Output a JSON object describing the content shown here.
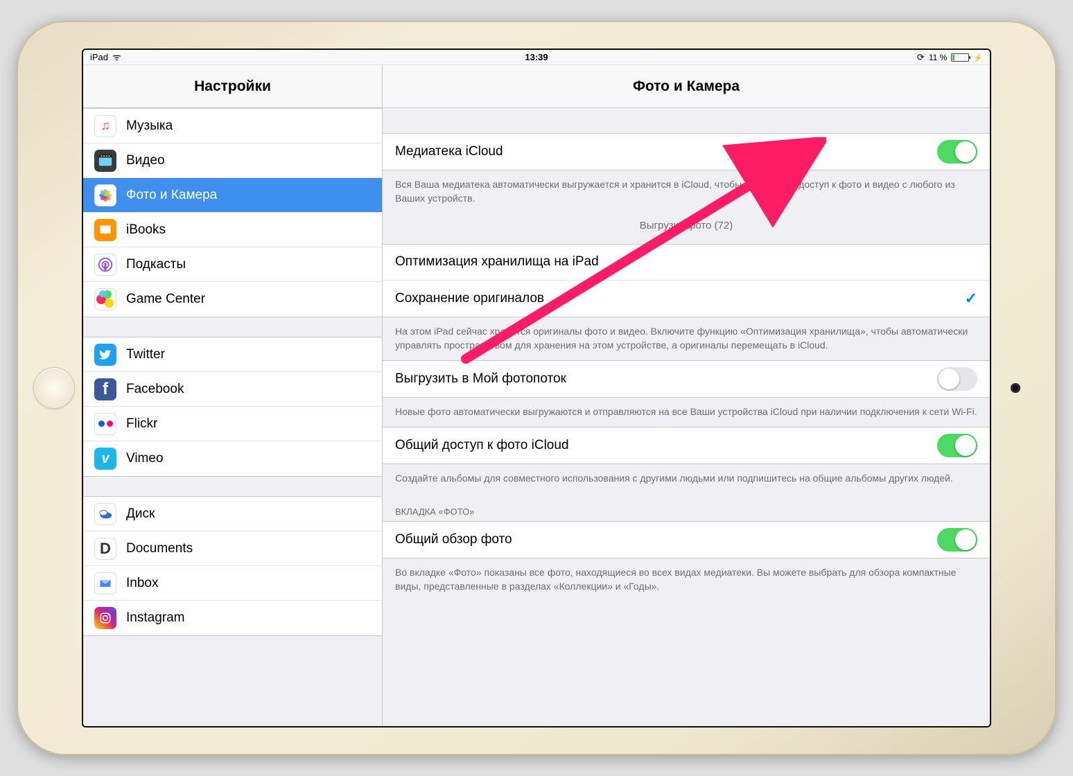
{
  "statusbar": {
    "device": "iPad",
    "time": "13:39",
    "battery_percent": "11 %"
  },
  "sidebar": {
    "title": "Настройки",
    "groups": [
      {
        "items": [
          {
            "id": "music",
            "label": "Музыка",
            "selected": false
          },
          {
            "id": "video",
            "label": "Видео",
            "selected": false
          },
          {
            "id": "photos",
            "label": "Фото и Камера",
            "selected": true
          },
          {
            "id": "ibooks",
            "label": "iBooks",
            "selected": false
          },
          {
            "id": "podcasts",
            "label": "Подкасты",
            "selected": false
          },
          {
            "id": "gamecenter",
            "label": "Game Center",
            "selected": false
          }
        ]
      },
      {
        "items": [
          {
            "id": "twitter",
            "label": "Twitter",
            "selected": false
          },
          {
            "id": "facebook",
            "label": "Facebook",
            "selected": false
          },
          {
            "id": "flickr",
            "label": "Flickr",
            "selected": false
          },
          {
            "id": "vimeo",
            "label": "Vimeo",
            "selected": false
          }
        ]
      },
      {
        "items": [
          {
            "id": "disk",
            "label": "Диск",
            "selected": false
          },
          {
            "id": "documents",
            "label": "Documents",
            "selected": false
          },
          {
            "id": "inbox",
            "label": "Inbox",
            "selected": false
          },
          {
            "id": "instagram",
            "label": "Instagram",
            "selected": false
          }
        ]
      }
    ]
  },
  "main": {
    "title": "Фото и Камера",
    "icloud_library": {
      "label": "Медиатека iCloud",
      "on": true,
      "footer": "Вся Ваша медиатека автоматически выгружается и хранится в iCloud, чтобы обеспечить доступ к фото и видео с любого из Ваших устройств.",
      "upload_status": "Выгрузка фото (72)"
    },
    "storage": {
      "optimize_label": "Оптимизация хранилища на iPad",
      "originals_label": "Сохранение оригиналов",
      "originals_selected": true,
      "footer": "На этом iPad сейчас хранятся оригиналы фото и видео. Включите функцию «Оптимизация хранилища», чтобы автоматически управлять пространством для хранения на этом устройстве, а оригиналы перемещать в iCloud."
    },
    "photostream": {
      "label": "Выгрузить в Мой фотопоток",
      "on": false,
      "footer": "Новые фото автоматически выгружаются и отправляются на все Ваши устройства iCloud при наличии подключения к сети Wi-Fi."
    },
    "sharing": {
      "label": "Общий доступ к фото iCloud",
      "on": true,
      "footer": "Создайте альбомы для совместного использования с другими людьми или подпишитесь на общие альбомы других людей."
    },
    "photos_tab": {
      "header": "ВКЛАДКА «ФОТО»",
      "overview_label": "Общий обзор фото",
      "overview_on": true,
      "footer": "Во вкладке «Фото» показаны все фото, находящиеся во всех видах медиатеки. Вы можете выбрать для обзора компактные виды, представленные в разделах «Коллекции» и «Годы»."
    }
  },
  "annotation": {
    "arrow_color": "#ff1c66",
    "highlights": "toggle-icloud-library"
  }
}
